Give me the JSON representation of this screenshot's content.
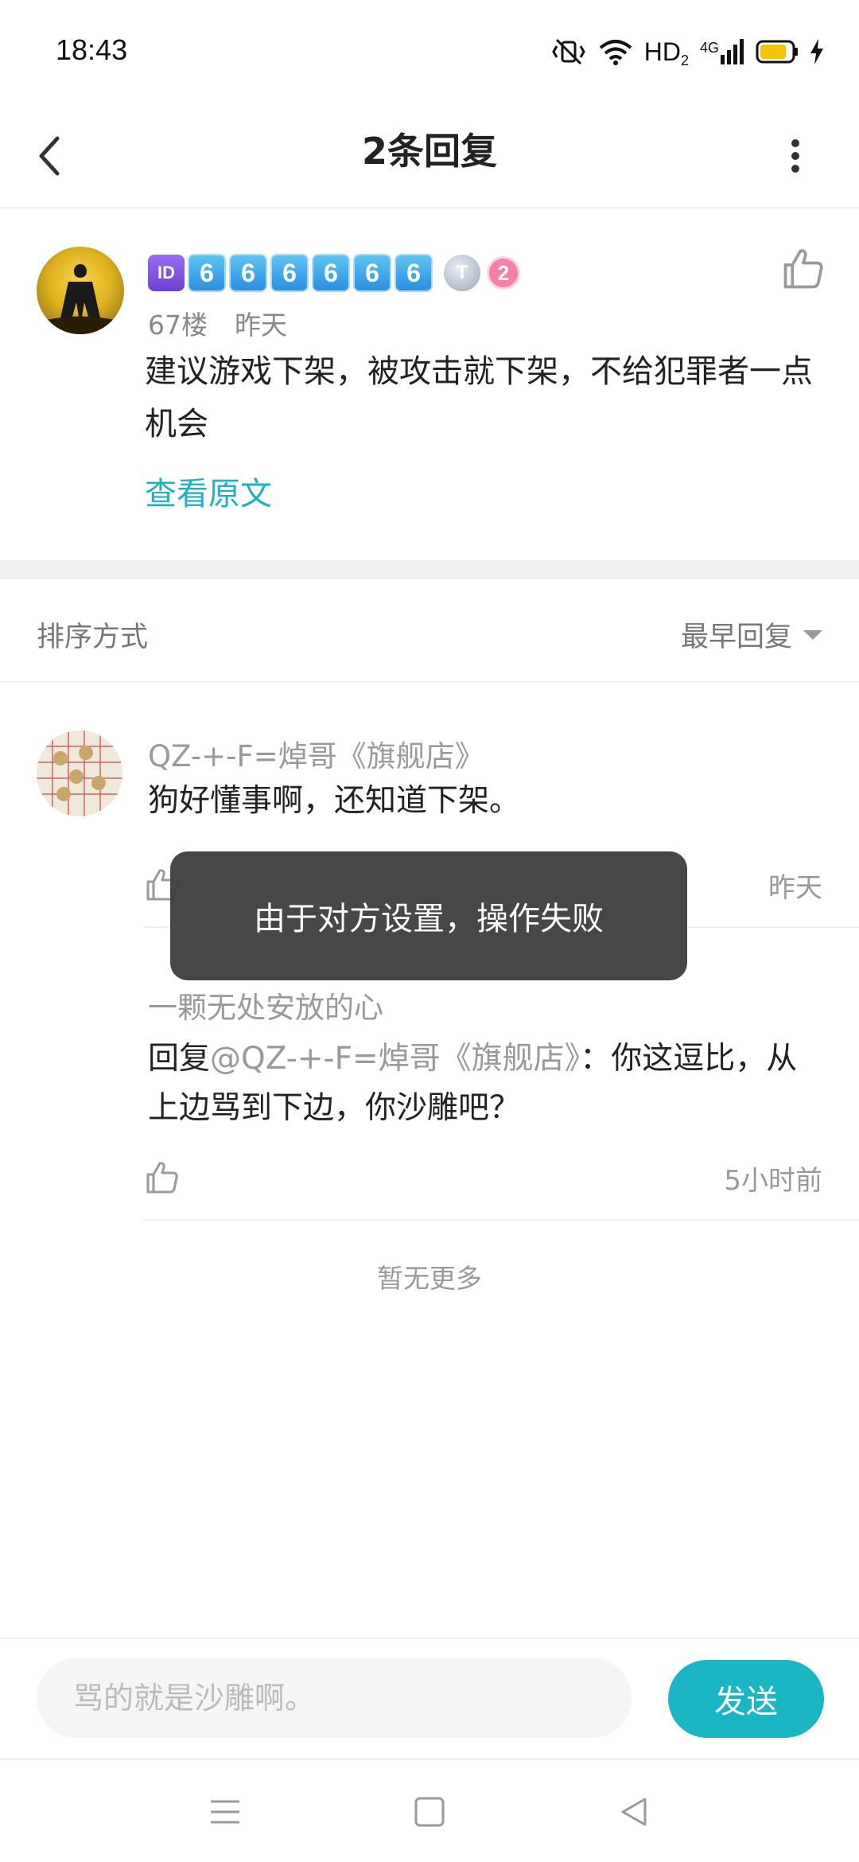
{
  "status_bar": {
    "time": "18:43",
    "hd_label": "HD",
    "hd_sub": "2",
    "network_label": "4G",
    "icons": [
      "mute-vibrate-icon",
      "wifi-icon",
      "signal-icon",
      "battery-icon",
      "charging-icon"
    ],
    "battery_level": 0.85
  },
  "header": {
    "title": "2条回复",
    "icons": [
      "back-arrow-icon",
      "more-vertical-icon"
    ]
  },
  "main_post": {
    "badge_id": "ID",
    "badge_digits": [
      "6",
      "6",
      "6",
      "6",
      "6",
      "6"
    ],
    "badge_title": "T",
    "badge_level": "2",
    "floor": "67楼",
    "time": "昨天",
    "content": "建议游戏下架，被攻击就下架，不给犯罪者一点机会",
    "view_original": "查看原文",
    "icons": [
      "thumbs-up-icon"
    ]
  },
  "sort_bar": {
    "label": "排序方式",
    "selected": "最早回复",
    "icons": [
      "caret-down-icon"
    ]
  },
  "replies": [
    {
      "author": "QZ-+-F=焯哥《旗舰店》",
      "text": "狗好懂事啊，还知道下架。",
      "time": "昨天"
    },
    {
      "author": "一颗无处安放的心",
      "reply_prefix": "回复",
      "mention": "@QZ-+-F=焯哥《旗舰店》",
      "text": "：你这逗比，从上边骂到下边，你沙雕吧？",
      "time": "5小时前"
    }
  ],
  "no_more": "暂无更多",
  "toast": "由于对方设置，操作失败",
  "composer": {
    "placeholder": "骂的就是沙雕啊。",
    "send_label": "发送"
  },
  "nav_bar": {
    "icons": [
      "menu-icon",
      "home-square-icon",
      "back-triangle-icon"
    ]
  },
  "colors": {
    "accent": "#1ab6c3",
    "link": "#1eb2c0",
    "muted_text": "#999999",
    "toast_bg": "#404040"
  }
}
